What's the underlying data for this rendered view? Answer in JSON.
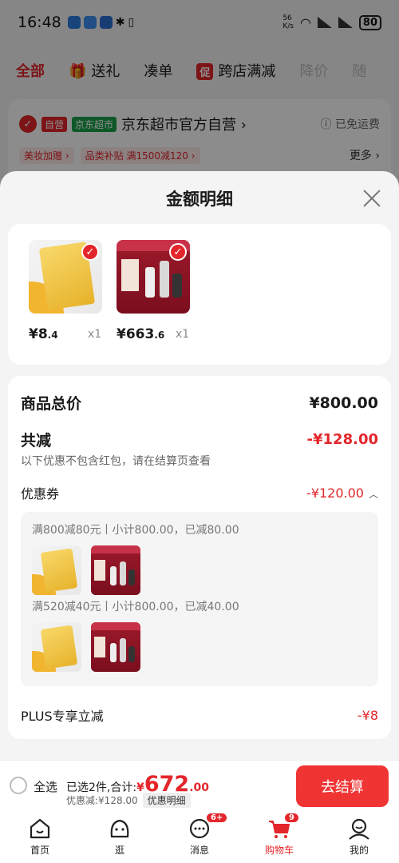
{
  "status_bar": {
    "time": "16:48",
    "net_speed": "56\nK/s",
    "battery": "80"
  },
  "filter_tabs": [
    {
      "label": "全部",
      "state": "active"
    },
    {
      "label": "送礼",
      "icon": "gift-icon"
    },
    {
      "label": "凑单"
    },
    {
      "label": "跨店满减",
      "badge": "促"
    },
    {
      "label": "降价",
      "state": "dim"
    },
    {
      "label": "随",
      "state": "dim"
    }
  ],
  "store": {
    "tag_self": "自营",
    "tag_market": "京东超市",
    "name": "京东超市官方自营 ›",
    "free_shipping": "ⓘ 已免运费",
    "promo1": "美妆加赠 ›",
    "promo2": "品类补贴  满1500减120 ›",
    "more": "更多 ›"
  },
  "sheet": {
    "title": "金额明细",
    "products": [
      {
        "price_int": "¥8",
        "price_dec": ".4",
        "qty": "x1"
      },
      {
        "price_int": "¥663",
        "price_dec": ".6",
        "qty": "x1"
      }
    ],
    "total_label": "商品总价",
    "total_value": "¥800.00",
    "reduce_label": "共减",
    "reduce_value": "-¥128.00",
    "reduce_note": "以下优惠不包含红包，请在结算页查看",
    "coupon_label": "优惠券",
    "coupon_value": "-¥120.00",
    "coupon_lines": [
      "满800减80元丨小计800.00，已减80.00",
      "满520减40元丨小计800.00，已减40.00"
    ],
    "plus_label": "PLUS专享立减",
    "plus_value": "-¥8"
  },
  "bottom_bar": {
    "select_all": "全选",
    "selected_text": "已选2件,合计:",
    "total_symbol": "¥",
    "total_int": "672",
    "total_dec": ".00",
    "discount_text": "优惠减:¥128.00",
    "detail_chip": "优惠明细",
    "checkout": "去结算"
  },
  "nav": [
    {
      "label": "首页",
      "icon": "home-icon"
    },
    {
      "label": "逛",
      "icon": "browse-face-icon"
    },
    {
      "label": "消息",
      "icon": "message-icon",
      "badge": "6+"
    },
    {
      "label": "购物车",
      "icon": "cart-icon",
      "badge": "9",
      "active": true
    },
    {
      "label": "我的",
      "icon": "profile-icon"
    }
  ],
  "colors": {
    "accent": "#e3262b",
    "checkout": "#f03434",
    "market_green": "#1aa14a"
  }
}
